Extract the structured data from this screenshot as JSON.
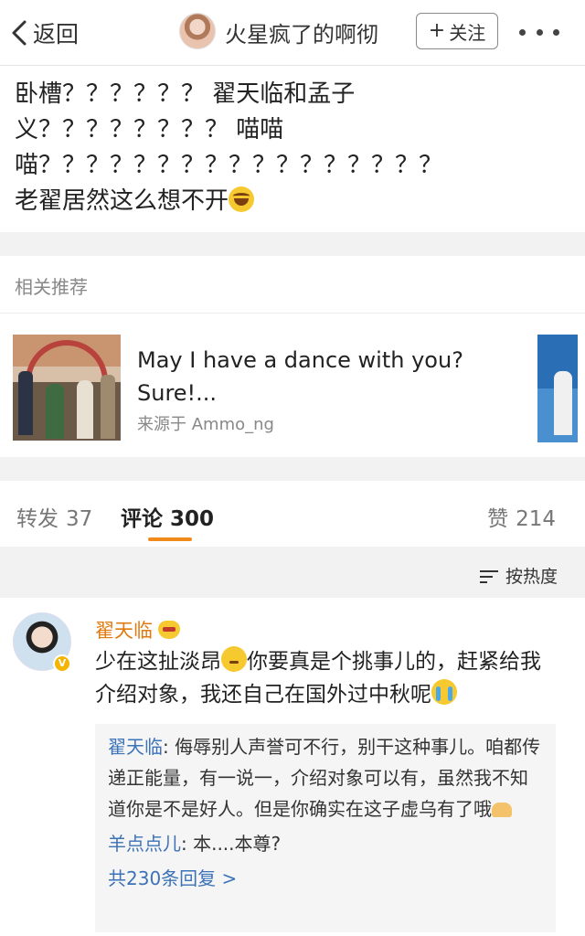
{
  "header": {
    "back_label": "返回",
    "username": "火星疯了的啊彻",
    "follow_label": "关注",
    "follow_plus": "+"
  },
  "post": {
    "lines": [
      "卧槽？？？？？？ 翟天临和孟子",
      "义？？？？？？？？ 喵喵",
      "喵？？？？？？？？？？？？？？？？？",
      "老翟居然这么想不开"
    ],
    "line4_emoji": "laughing-crying-emoji"
  },
  "related": {
    "title": "相关推荐",
    "item_text": "May I have a dance with you? Sure!...",
    "item_source": "来源于 Ammo_ng"
  },
  "tabs": {
    "repost_label": "转发",
    "repost_count": "37",
    "comment_label": "评论",
    "comment_count": "300",
    "like_label": "赞",
    "like_count": "214",
    "accent": "#f08a1a"
  },
  "sort": {
    "label": "按热度"
  },
  "comment": {
    "author": "翟天临",
    "text_parts": [
      "少在这扯淡昂",
      "你要真是个挑事儿的，赶紧给我介绍对象，我还自己在国外过中秋呢"
    ],
    "replies": [
      {
        "name": "翟天临",
        "text": ": 侮辱别人声誉可不行，别干这种事儿。咱都传递正能量，有一说一，介绍对象可以有，虽然我不知道你是不是好人。但是你确实在这子虚乌有了哦"
      },
      {
        "name": "羊点点儿",
        "text": ": 本....本尊?"
      }
    ],
    "more_replies": "共230条回复 >",
    "name_color": "#e07a10",
    "link_color": "#3b72b8"
  }
}
